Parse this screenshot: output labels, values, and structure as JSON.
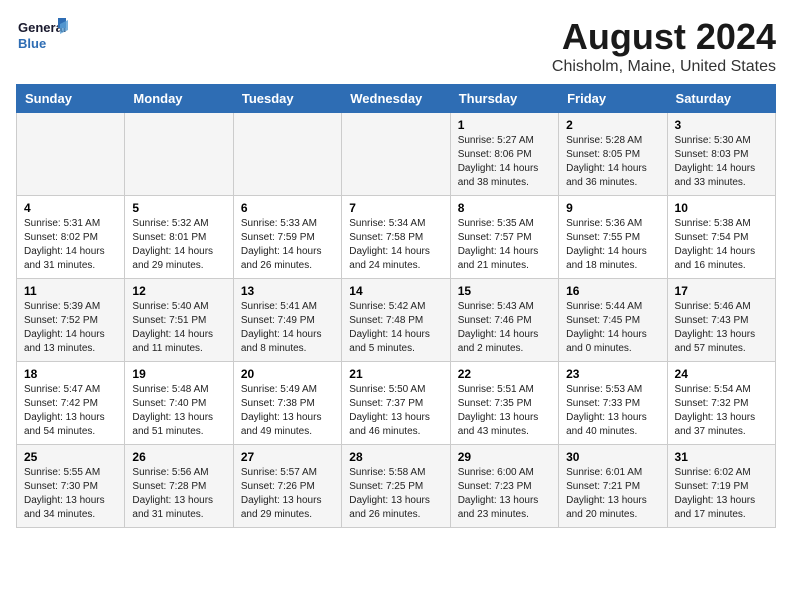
{
  "logo": {
    "line1": "General",
    "line2": "Blue"
  },
  "title": "August 2024",
  "subtitle": "Chisholm, Maine, United States",
  "days_of_week": [
    "Sunday",
    "Monday",
    "Tuesday",
    "Wednesday",
    "Thursday",
    "Friday",
    "Saturday"
  ],
  "weeks": [
    [
      {
        "day": "",
        "info": ""
      },
      {
        "day": "",
        "info": ""
      },
      {
        "day": "",
        "info": ""
      },
      {
        "day": "",
        "info": ""
      },
      {
        "day": "1",
        "info": "Sunrise: 5:27 AM\nSunset: 8:06 PM\nDaylight: 14 hours\nand 38 minutes."
      },
      {
        "day": "2",
        "info": "Sunrise: 5:28 AM\nSunset: 8:05 PM\nDaylight: 14 hours\nand 36 minutes."
      },
      {
        "day": "3",
        "info": "Sunrise: 5:30 AM\nSunset: 8:03 PM\nDaylight: 14 hours\nand 33 minutes."
      }
    ],
    [
      {
        "day": "4",
        "info": "Sunrise: 5:31 AM\nSunset: 8:02 PM\nDaylight: 14 hours\nand 31 minutes."
      },
      {
        "day": "5",
        "info": "Sunrise: 5:32 AM\nSunset: 8:01 PM\nDaylight: 14 hours\nand 29 minutes."
      },
      {
        "day": "6",
        "info": "Sunrise: 5:33 AM\nSunset: 7:59 PM\nDaylight: 14 hours\nand 26 minutes."
      },
      {
        "day": "7",
        "info": "Sunrise: 5:34 AM\nSunset: 7:58 PM\nDaylight: 14 hours\nand 24 minutes."
      },
      {
        "day": "8",
        "info": "Sunrise: 5:35 AM\nSunset: 7:57 PM\nDaylight: 14 hours\nand 21 minutes."
      },
      {
        "day": "9",
        "info": "Sunrise: 5:36 AM\nSunset: 7:55 PM\nDaylight: 14 hours\nand 18 minutes."
      },
      {
        "day": "10",
        "info": "Sunrise: 5:38 AM\nSunset: 7:54 PM\nDaylight: 14 hours\nand 16 minutes."
      }
    ],
    [
      {
        "day": "11",
        "info": "Sunrise: 5:39 AM\nSunset: 7:52 PM\nDaylight: 14 hours\nand 13 minutes."
      },
      {
        "day": "12",
        "info": "Sunrise: 5:40 AM\nSunset: 7:51 PM\nDaylight: 14 hours\nand 11 minutes."
      },
      {
        "day": "13",
        "info": "Sunrise: 5:41 AM\nSunset: 7:49 PM\nDaylight: 14 hours\nand 8 minutes."
      },
      {
        "day": "14",
        "info": "Sunrise: 5:42 AM\nSunset: 7:48 PM\nDaylight: 14 hours\nand 5 minutes."
      },
      {
        "day": "15",
        "info": "Sunrise: 5:43 AM\nSunset: 7:46 PM\nDaylight: 14 hours\nand 2 minutes."
      },
      {
        "day": "16",
        "info": "Sunrise: 5:44 AM\nSunset: 7:45 PM\nDaylight: 14 hours\nand 0 minutes."
      },
      {
        "day": "17",
        "info": "Sunrise: 5:46 AM\nSunset: 7:43 PM\nDaylight: 13 hours\nand 57 minutes."
      }
    ],
    [
      {
        "day": "18",
        "info": "Sunrise: 5:47 AM\nSunset: 7:42 PM\nDaylight: 13 hours\nand 54 minutes."
      },
      {
        "day": "19",
        "info": "Sunrise: 5:48 AM\nSunset: 7:40 PM\nDaylight: 13 hours\nand 51 minutes."
      },
      {
        "day": "20",
        "info": "Sunrise: 5:49 AM\nSunset: 7:38 PM\nDaylight: 13 hours\nand 49 minutes."
      },
      {
        "day": "21",
        "info": "Sunrise: 5:50 AM\nSunset: 7:37 PM\nDaylight: 13 hours\nand 46 minutes."
      },
      {
        "day": "22",
        "info": "Sunrise: 5:51 AM\nSunset: 7:35 PM\nDaylight: 13 hours\nand 43 minutes."
      },
      {
        "day": "23",
        "info": "Sunrise: 5:53 AM\nSunset: 7:33 PM\nDaylight: 13 hours\nand 40 minutes."
      },
      {
        "day": "24",
        "info": "Sunrise: 5:54 AM\nSunset: 7:32 PM\nDaylight: 13 hours\nand 37 minutes."
      }
    ],
    [
      {
        "day": "25",
        "info": "Sunrise: 5:55 AM\nSunset: 7:30 PM\nDaylight: 13 hours\nand 34 minutes."
      },
      {
        "day": "26",
        "info": "Sunrise: 5:56 AM\nSunset: 7:28 PM\nDaylight: 13 hours\nand 31 minutes."
      },
      {
        "day": "27",
        "info": "Sunrise: 5:57 AM\nSunset: 7:26 PM\nDaylight: 13 hours\nand 29 minutes."
      },
      {
        "day": "28",
        "info": "Sunrise: 5:58 AM\nSunset: 7:25 PM\nDaylight: 13 hours\nand 26 minutes."
      },
      {
        "day": "29",
        "info": "Sunrise: 6:00 AM\nSunset: 7:23 PM\nDaylight: 13 hours\nand 23 minutes."
      },
      {
        "day": "30",
        "info": "Sunrise: 6:01 AM\nSunset: 7:21 PM\nDaylight: 13 hours\nand 20 minutes."
      },
      {
        "day": "31",
        "info": "Sunrise: 6:02 AM\nSunset: 7:19 PM\nDaylight: 13 hours\nand 17 minutes."
      }
    ]
  ]
}
